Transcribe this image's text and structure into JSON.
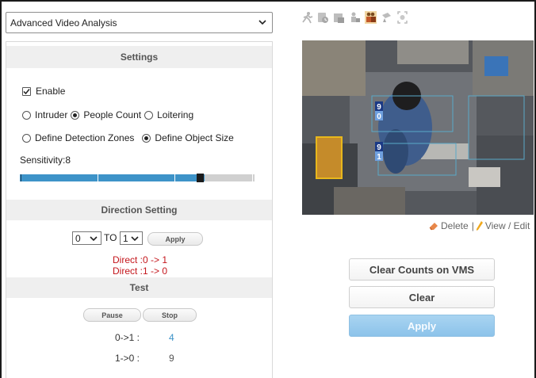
{
  "mode_select": {
    "value": "Advanced Video Analysis"
  },
  "settings": {
    "header": "Settings",
    "enable_label": "Enable",
    "enabled": true,
    "analysis_types": [
      {
        "label": "Intruder",
        "selected": false
      },
      {
        "label": "People Count",
        "selected": true
      },
      {
        "label": "Loitering",
        "selected": false
      }
    ],
    "zone_options": [
      {
        "label": "Define Detection Zones",
        "selected": false
      },
      {
        "label": "Define Object Size",
        "selected": true
      }
    ],
    "sensitivity_label": "Sensitivity:8",
    "sensitivity_value": 8,
    "sensitivity_max": 10
  },
  "direction": {
    "header": "Direction Setting",
    "from_value": "0",
    "to_label": "TO",
    "to_value": "1",
    "apply_label": "Apply",
    "direct_lines": [
      "Direct :0 -> 1",
      "Direct :1 -> 0"
    ]
  },
  "test": {
    "header": "Test",
    "pause_label": "Pause",
    "stop_label": "Stop",
    "counts": [
      {
        "label": "0->1 :",
        "value": "4"
      },
      {
        "label": "1->0 :",
        "value": "9"
      }
    ]
  },
  "video": {
    "zone_labels": [
      {
        "top": "9",
        "bottom": "0"
      },
      {
        "top": "9",
        "bottom": "1"
      }
    ],
    "delete_label": "Delete",
    "separator": "|",
    "view_edit_label": "View / Edit"
  },
  "toolbar_icons": [
    "intruder-icon",
    "loitering-icon",
    "object-left-icon",
    "object-removed-icon",
    "people-count-icon",
    "tamper-icon",
    "face-detect-icon"
  ],
  "actions": {
    "clear_counts_vms": "Clear Counts on VMS",
    "clear": "Clear",
    "apply": "Apply"
  },
  "colors": {
    "accent_blue": "#3d93c8",
    "direct_red": "#c4161c",
    "count_blue": "#3d93c8",
    "apply_blue": "#8cc3ea",
    "section_bg": "#efefef"
  }
}
